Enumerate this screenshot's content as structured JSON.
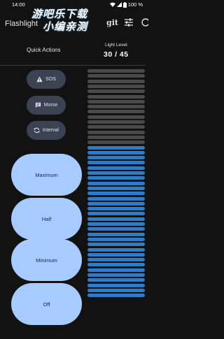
{
  "status_bar": {
    "time": "14:00",
    "battery": "100 %"
  },
  "app_bar": {
    "title": "Flashlight",
    "git_label": "git"
  },
  "banner": {
    "line1": "游吧乐下载",
    "line2": "小编亲测"
  },
  "quick_actions": {
    "title": "Quick Actions",
    "sos_label": "SOS",
    "morse_label": "Morse",
    "interval_label": "Interval"
  },
  "light_level": {
    "label": "Light Level:",
    "value": "30 / 45",
    "current": 30,
    "max": 45
  },
  "brightness_buttons": {
    "maximum": "Maximum",
    "half": "Half",
    "minimum": "Minimum",
    "off": "Off"
  },
  "colors": {
    "background": "#121212",
    "active_bar": "#2e7cc7",
    "inactive_bar": "#4a4a4a",
    "big_button": "#a8cbff",
    "pill_button": "#3b4251"
  },
  "icons": {
    "sos": "warning-icon",
    "morse": "chat-icon",
    "interval": "sync-icon",
    "tune": "tune-icon",
    "more": "more-icon"
  }
}
